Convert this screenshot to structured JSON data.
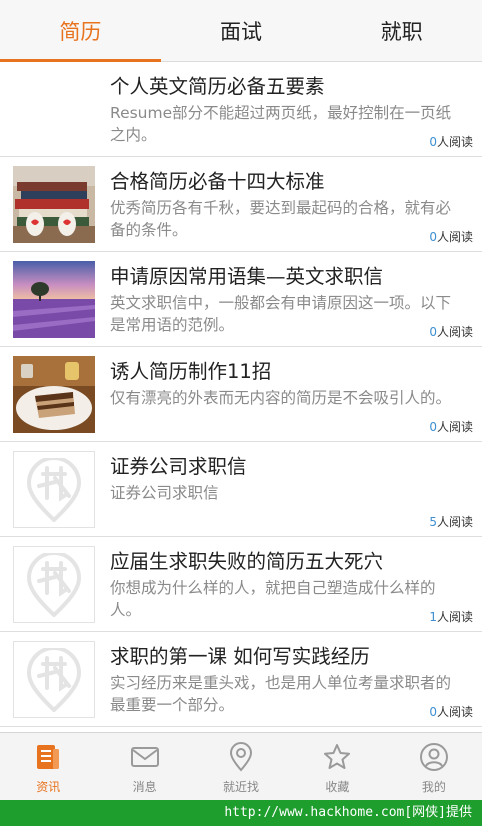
{
  "tabs": [
    {
      "label": "简历",
      "active": true
    },
    {
      "label": "面试",
      "active": false
    },
    {
      "label": "就职",
      "active": false
    }
  ],
  "read_suffix": "人阅读",
  "articles": [
    {
      "title": "个人英文简历必备五要素",
      "desc": "Resume部分不能超过两页纸，最好控制在一页纸之内。",
      "reads": "0",
      "thumb": "none"
    },
    {
      "title": "合格简历必备十四大标准",
      "desc": "优秀简历各有千秋，要达到最起码的合格，就有必备的条件。",
      "reads": "0",
      "thumb": "books-photo"
    },
    {
      "title": "申请原因常用语集—英文求职信",
      "desc": "英文求职信中，一般都会有申请原因这一项。以下是常用语的范例。",
      "reads": "0",
      "thumb": "lavender-photo"
    },
    {
      "title": "诱人简历制作11招",
      "desc": "仅有漂亮的外表而无内容的简历是不会吸引人的。",
      "reads": "0",
      "thumb": "cake-photo"
    },
    {
      "title": "证券公司求职信",
      "desc": "证券公司求职信",
      "reads": "5",
      "thumb": "placeholder-logo"
    },
    {
      "title": "应届生求职失败的简历五大死穴",
      "desc": "你想成为什么样的人，就把自己塑造成什么样的人。",
      "reads": "1",
      "thumb": "placeholder-logo"
    },
    {
      "title": "求职的第一课 如何写实践经历",
      "desc": "实习经历来是重头戏，也是用人单位考量求职者的最重要一个部分。",
      "reads": "0",
      "thumb": "placeholder-logo"
    }
  ],
  "bottom_nav": [
    {
      "label": "资讯",
      "icon": "news-icon",
      "active": true
    },
    {
      "label": "消息",
      "icon": "mail-icon",
      "active": false
    },
    {
      "label": "就近找",
      "icon": "location-pin-icon",
      "active": false
    },
    {
      "label": "收藏",
      "icon": "star-icon",
      "active": false
    },
    {
      "label": "我的",
      "icon": "user-icon",
      "active": false
    }
  ],
  "watermark": "http://www.hackhome.com[网侠]提供",
  "colors": {
    "accent": "#e8731e",
    "count": "#3d8fd1",
    "watermark_bg": "#1e9e2d"
  }
}
